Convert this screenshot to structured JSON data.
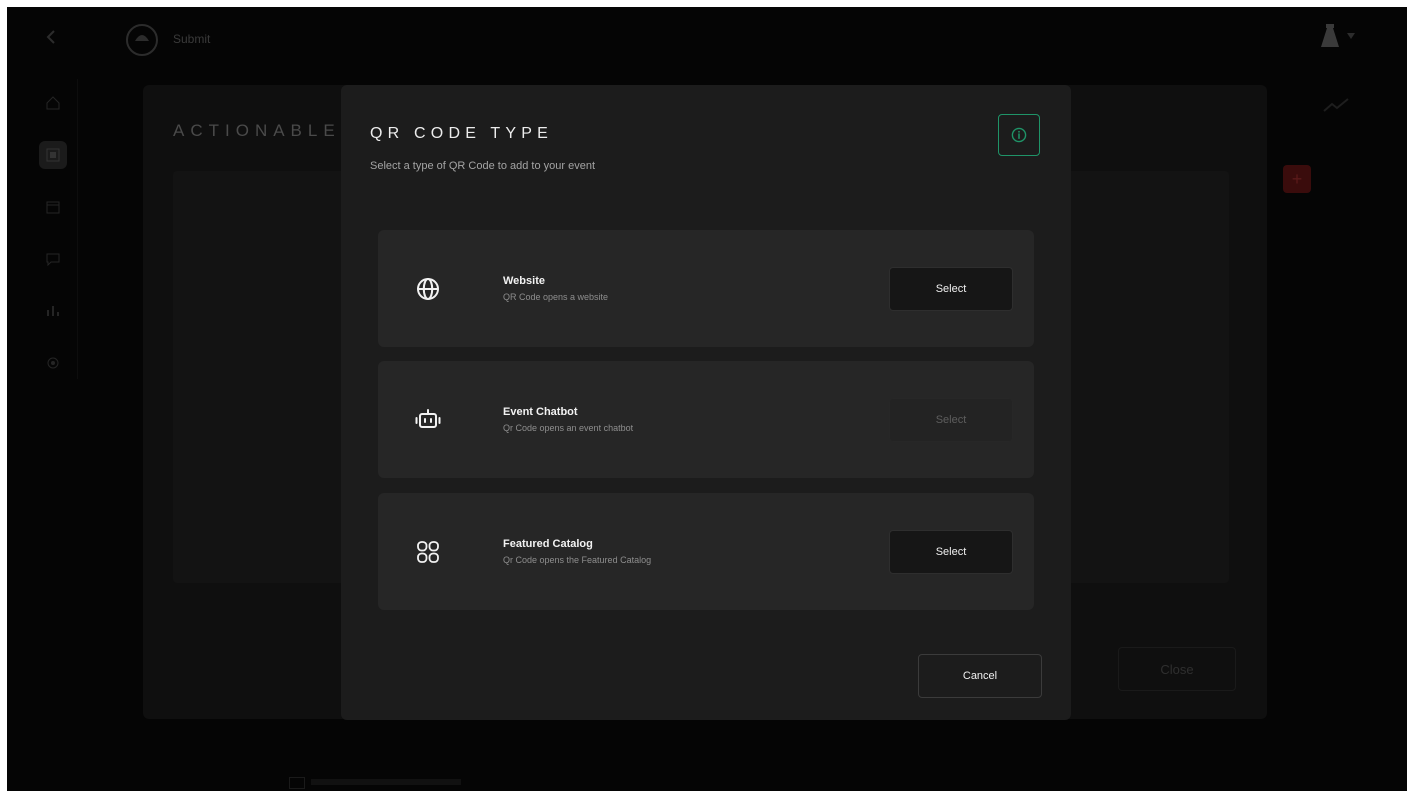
{
  "app": {
    "name": "Submit"
  },
  "background": {
    "panel_title": "ACTIONABLE I",
    "close_label": "Close",
    "add_label": "+"
  },
  "modal": {
    "title": "QR CODE TYPE",
    "subtitle": "Select a type of QR Code to add to your event",
    "info_icon": "info-icon",
    "cancel_label": "Cancel",
    "accent_color": "#1f9468",
    "options": [
      {
        "name": "Website",
        "description": "QR Code opens a website",
        "icon": "globe-icon",
        "button_label": "Select",
        "enabled": true
      },
      {
        "name": "Event Chatbot",
        "description": "Qr Code opens an event chatbot",
        "icon": "robot-icon",
        "button_label": "Select",
        "enabled": false
      },
      {
        "name": "Featured Catalog",
        "description": "Qr Code opens the Featured Catalog",
        "icon": "grid-icon",
        "button_label": "Select",
        "enabled": true
      }
    ]
  }
}
